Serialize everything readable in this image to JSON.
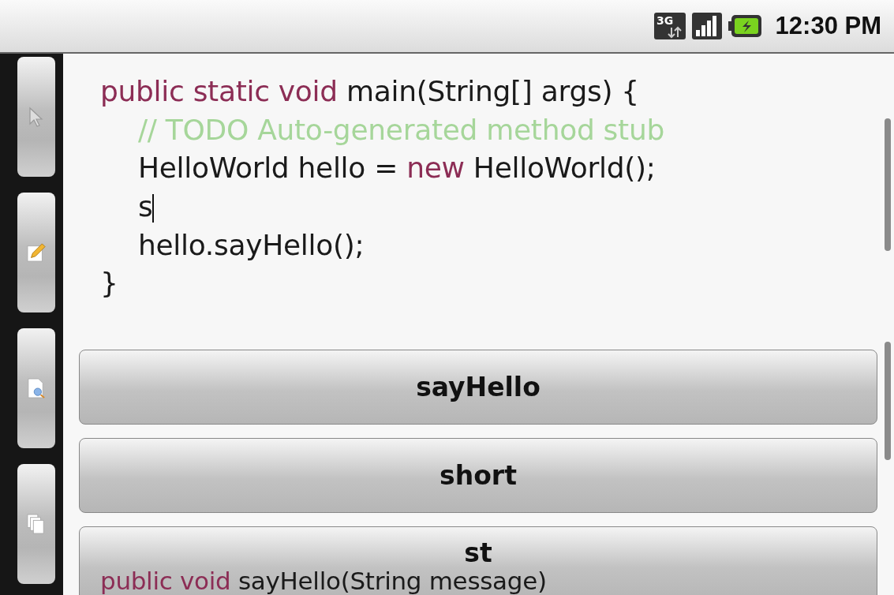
{
  "status_bar": {
    "time": "12:30 PM",
    "network": "3G"
  },
  "editor": {
    "sections": [
      {
        "lines": [
          {
            "segments": [
              {
                "kind": "keyword",
                "text": "public static void"
              },
              {
                "kind": "plain",
                "text": " main(String[] args) {"
              }
            ],
            "children": [
              {
                "segments": [
                  {
                    "kind": "comment",
                    "text": "// TODO Auto-generated method stub"
                  }
                ]
              },
              {
                "segments": [
                  {
                    "kind": "plain",
                    "text": "HelloWorld hello = "
                  },
                  {
                    "kind": "keyword",
                    "text": "new"
                  },
                  {
                    "kind": "plain",
                    "text": " HelloWorld();"
                  }
                ]
              },
              {
                "segments": [
                  {
                    "kind": "plain",
                    "text": "s"
                  }
                ],
                "cursor": true
              },
              {
                "segments": [
                  {
                    "kind": "plain",
                    "text": "hello.sayHello();"
                  }
                ]
              }
            ]
          },
          {
            "segments": [
              {
                "kind": "plain",
                "text": "}"
              }
            ]
          }
        ]
      },
      {
        "lines": [
          {
            "segments": [
              {
                "kind": "keyword",
                "text": "public void"
              },
              {
                "kind": "plain",
                "text": " sayHello(String message)"
              }
            ]
          }
        ]
      }
    ]
  },
  "suggestions": [
    {
      "label": "sayHello"
    },
    {
      "label": "short"
    },
    {
      "label": "st"
    }
  ]
}
